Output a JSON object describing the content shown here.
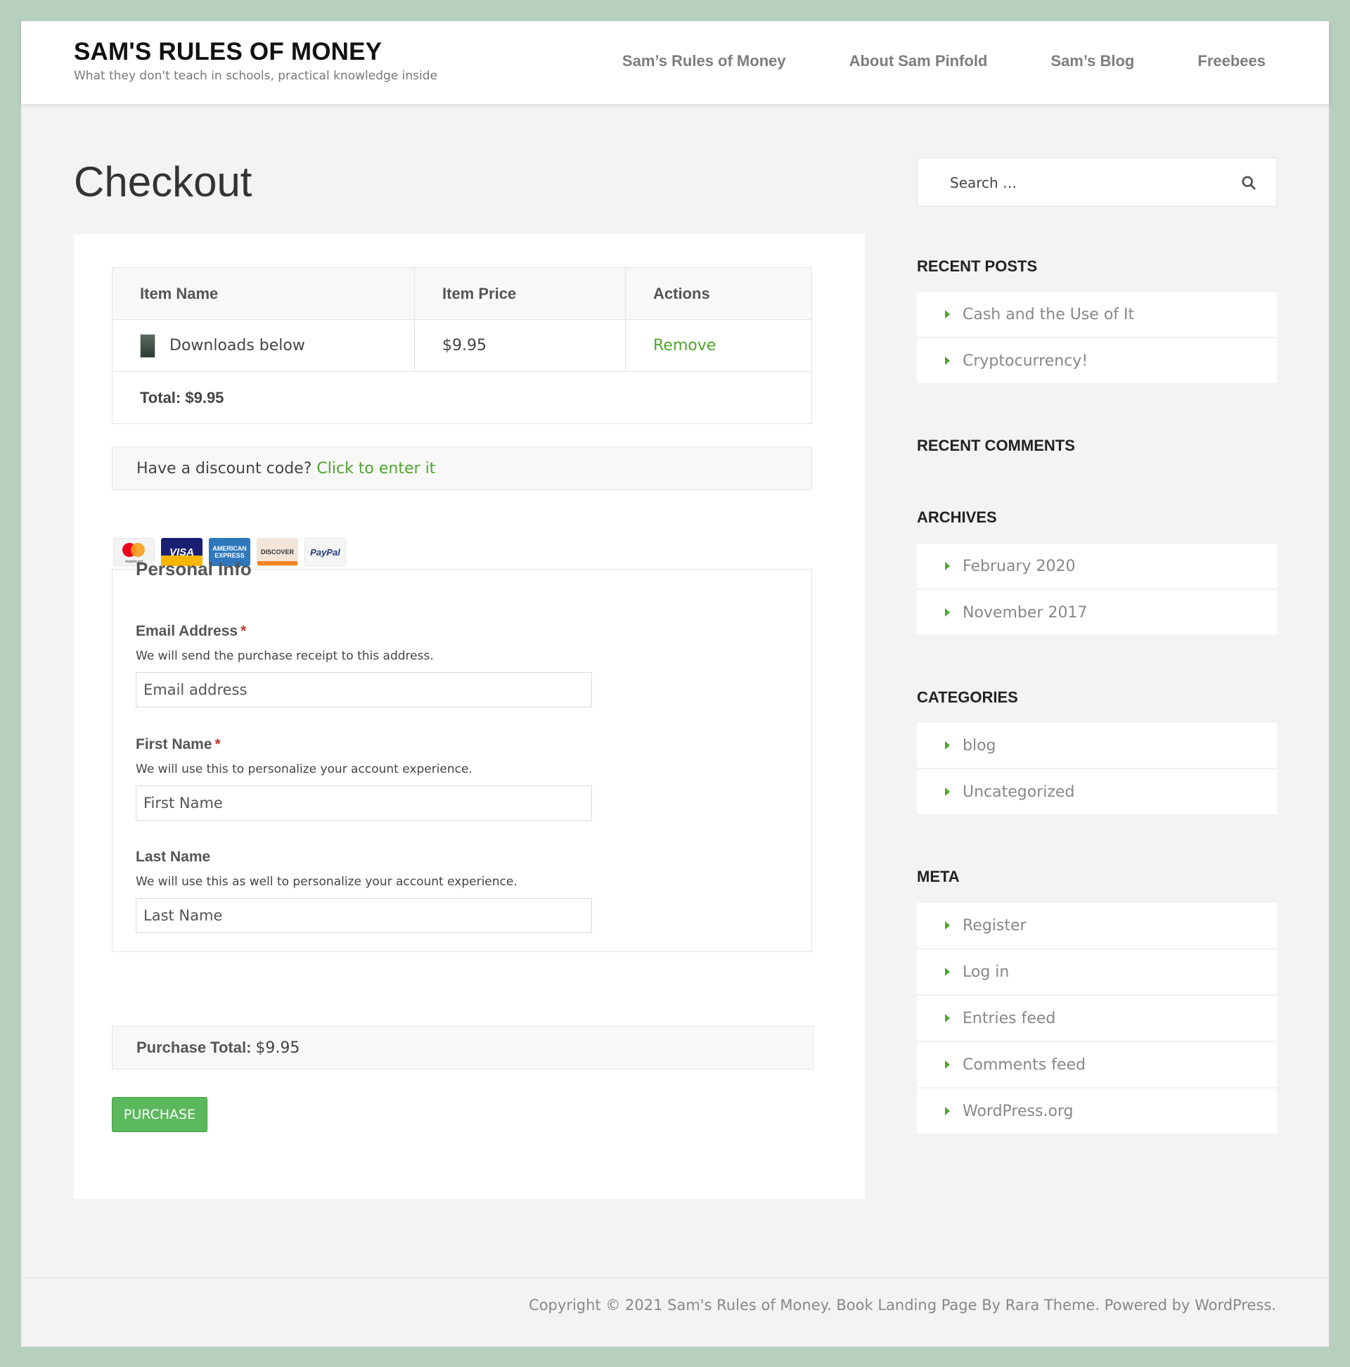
{
  "site": {
    "title": "SAM'S RULES OF MONEY",
    "tagline": "What they don't teach in schools, practical knowledge inside"
  },
  "nav": [
    {
      "label": "Sam’s Rules of Money"
    },
    {
      "label": "About Sam Pinfold"
    },
    {
      "label": "Sam’s Blog"
    },
    {
      "label": "Freebees"
    }
  ],
  "page": {
    "title": "Checkout"
  },
  "cart": {
    "headers": {
      "name": "Item Name",
      "price": "Item Price",
      "actions": "Actions"
    },
    "items": [
      {
        "name": "Downloads below",
        "price": "$9.95",
        "action": "Remove"
      }
    ],
    "total": "Total: $9.95"
  },
  "discount": {
    "prompt": "Have a discount code?",
    "link": "Click to enter it"
  },
  "payment_cards": [
    "mastercard",
    "VISA",
    "AMERICAN EXPRESS",
    "DISCOVER",
    "PayPal"
  ],
  "mastercard_label": "mastercard",
  "personal_info": {
    "legend": "Personal Info",
    "email": {
      "label": "Email Address",
      "required": "*",
      "desc": "We will send the purchase receipt to this address.",
      "placeholder": "Email address"
    },
    "first_name": {
      "label": "First Name",
      "required": "*",
      "desc": "We will use this to personalize your account experience.",
      "placeholder": "First Name"
    },
    "last_name": {
      "label": "Last Name",
      "desc": "We will use this as well to personalize your account experience.",
      "placeholder": "Last Name"
    }
  },
  "purchase": {
    "total_label": "Purchase Total:",
    "total_value": "$9.95",
    "button": "PURCHASE"
  },
  "sidebar": {
    "search_placeholder": "Search …",
    "recent_posts": {
      "title": "RECENT POSTS",
      "items": [
        "Cash and the Use of It",
        "Cryptocurrency!"
      ]
    },
    "recent_comments": {
      "title": "RECENT COMMENTS"
    },
    "archives": {
      "title": "ARCHIVES",
      "items": [
        "February 2020",
        "November 2017"
      ]
    },
    "categories": {
      "title": "CATEGORIES",
      "items": [
        "blog",
        "Uncategorized"
      ]
    },
    "meta": {
      "title": "META",
      "items": [
        "Register",
        "Log in",
        "Entries feed",
        "Comments feed",
        "WordPress.org"
      ]
    }
  },
  "footer": {
    "copyright": "Copyright © 2021 Sam's Rules of Money. Book Landing Page By Rara Theme. Powered by WordPress."
  },
  "colors": {
    "accent_green": "#4ea52c",
    "button_green": "#5cb85c",
    "frame_bg": "#b7cfbf"
  }
}
